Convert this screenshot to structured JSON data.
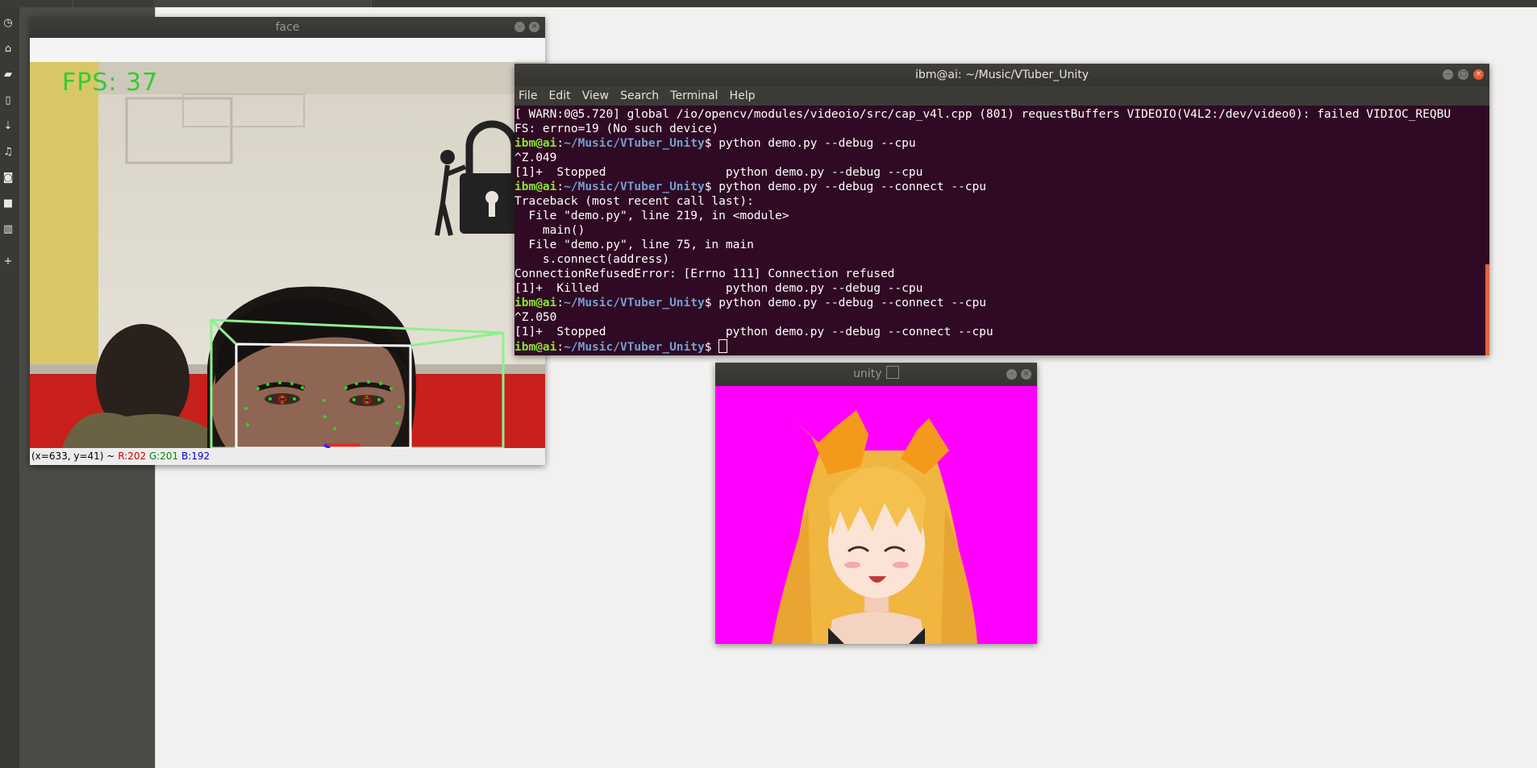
{
  "desktop": {
    "sidebar_icons": [
      "clock-icon",
      "home-icon",
      "folder-icon",
      "document-icon",
      "download-icon",
      "music-icon",
      "camera-icon",
      "video-icon",
      "trash-icon",
      "plus-icon"
    ]
  },
  "face_window": {
    "title": "face",
    "fps_overlay": "FPS: 37",
    "status": {
      "coords": "(x=633, y=41) ~",
      "r": "R:202",
      "g": "G:201",
      "b": "B:192"
    },
    "colors": {
      "r": "#cc0000",
      "g": "#008800",
      "b": "#0000cc",
      "overlay": "#33cc33"
    }
  },
  "terminal": {
    "title": "ibm@ai: ~/Music/VTuber_Unity",
    "menu": [
      "File",
      "Edit",
      "View",
      "Search",
      "Terminal",
      "Help"
    ],
    "prompt_user": "ibm@ai",
    "prompt_sep": ":",
    "prompt_path": "~/Music/VTuber_Unity",
    "prompt_end": "$ ",
    "lines": [
      {
        "type": "text",
        "text": "[ WARN:0@5.720] global /io/opencv/modules/videoio/src/cap_v4l.cpp (801) requestBuffers VIDEOIO(V4L2:/dev/video0): failed VIDIOC_REQBU"
      },
      {
        "type": "text",
        "text": "FS: errno=19 (No such device)"
      },
      {
        "type": "prompt",
        "text": "python demo.py --debug --cpu"
      },
      {
        "type": "text",
        "text": "^Z.049"
      },
      {
        "type": "text",
        "text": "[1]+  Stopped                 python demo.py --debug --cpu"
      },
      {
        "type": "prompt",
        "text": "python demo.py --debug --connect --cpu"
      },
      {
        "type": "text",
        "text": "Traceback (most recent call last):"
      },
      {
        "type": "text",
        "text": "  File \"demo.py\", line 219, in <module>"
      },
      {
        "type": "text",
        "text": "    main()"
      },
      {
        "type": "text",
        "text": "  File \"demo.py\", line 75, in main"
      },
      {
        "type": "text",
        "text": "    s.connect(address)"
      },
      {
        "type": "text",
        "text": "ConnectionRefusedError: [Errno 111] Connection refused"
      },
      {
        "type": "text",
        "text": "[1]+  Killed                  python demo.py --debug --cpu"
      },
      {
        "type": "prompt",
        "text": "python demo.py --debug --connect --cpu"
      },
      {
        "type": "text",
        "text": "^Z.050"
      },
      {
        "type": "text",
        "text": "[1]+  Stopped                 python demo.py --debug --connect --cpu"
      },
      {
        "type": "prompt",
        "text": "",
        "cursor": true
      }
    ],
    "colors": {
      "bg": "#300a24",
      "user": "#8ae234",
      "path": "#729fcf"
    }
  },
  "unity_window": {
    "title": "unity",
    "background": "#ff00ff"
  }
}
